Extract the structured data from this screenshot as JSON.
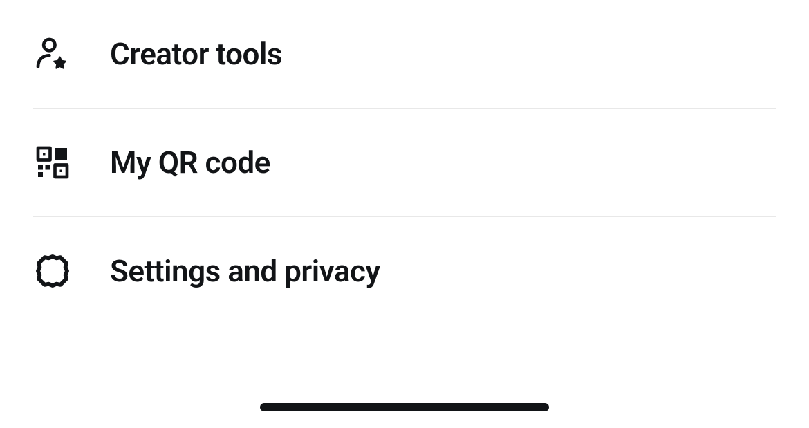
{
  "menu": {
    "items": [
      {
        "label": "Creator tools",
        "icon": "creator-star-icon"
      },
      {
        "label": "My QR code",
        "icon": "qr-code-icon"
      },
      {
        "label": "Settings and privacy",
        "icon": "gear-icon"
      }
    ]
  }
}
